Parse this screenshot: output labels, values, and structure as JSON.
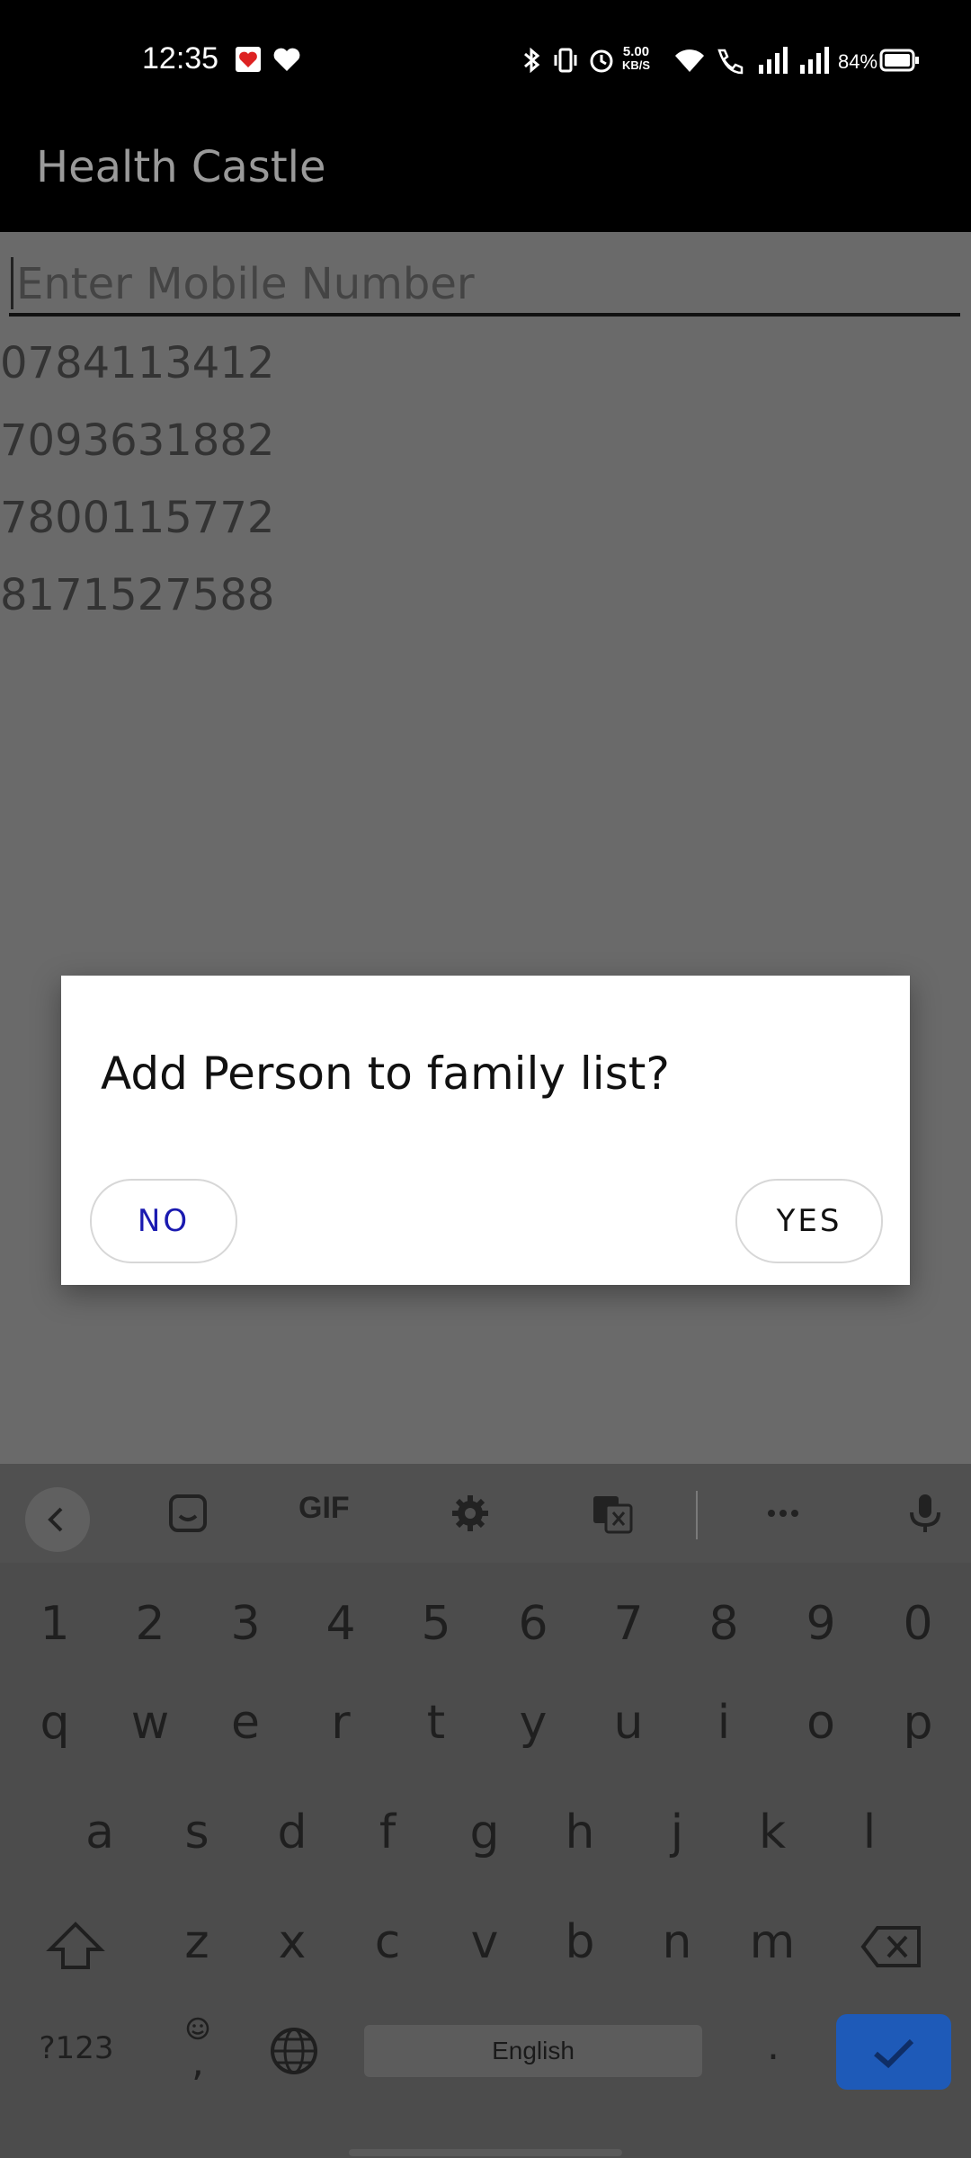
{
  "status_bar": {
    "time": "12:35",
    "net_speed_value": "5.00",
    "net_speed_unit": "KB/S",
    "battery": "84%"
  },
  "app_bar": {
    "title": "Health Castle"
  },
  "search": {
    "placeholder": "Enter Mobile Number"
  },
  "numbers": [
    "0784113412",
    "7093631882",
    "7800115772",
    "8171527588"
  ],
  "dialog": {
    "message": "Add Person to family list?",
    "no_label": "NO",
    "yes_label": "YES"
  },
  "keyboard": {
    "toolbar_gif": "GIF",
    "row_numbers": [
      "1",
      "2",
      "3",
      "4",
      "5",
      "6",
      "7",
      "8",
      "9",
      "0"
    ],
    "row_1": [
      "q",
      "w",
      "e",
      "r",
      "t",
      "y",
      "u",
      "i",
      "o",
      "p"
    ],
    "row_2": [
      "a",
      "s",
      "d",
      "f",
      "g",
      "h",
      "j",
      "k",
      "l"
    ],
    "row_3": [
      "z",
      "x",
      "c",
      "v",
      "b",
      "n",
      "m"
    ],
    "symbols_label": "?123",
    "comma": ",",
    "space_label": "English",
    "period": "."
  },
  "colors": {
    "accent_enter": "#1e5ab8",
    "dialog_no": "#1a1ab0"
  },
  "icons": [
    "bluetooth-icon",
    "vibrate-icon",
    "alarm-icon",
    "wifi-icon",
    "wifi-calling-icon",
    "signal-icon",
    "battery-icon",
    "sticker-icon",
    "gear-icon",
    "translate-icon",
    "more-icon",
    "mic-icon",
    "shift-icon",
    "backspace-icon",
    "globe-icon",
    "check-icon",
    "emoji-icon"
  ]
}
